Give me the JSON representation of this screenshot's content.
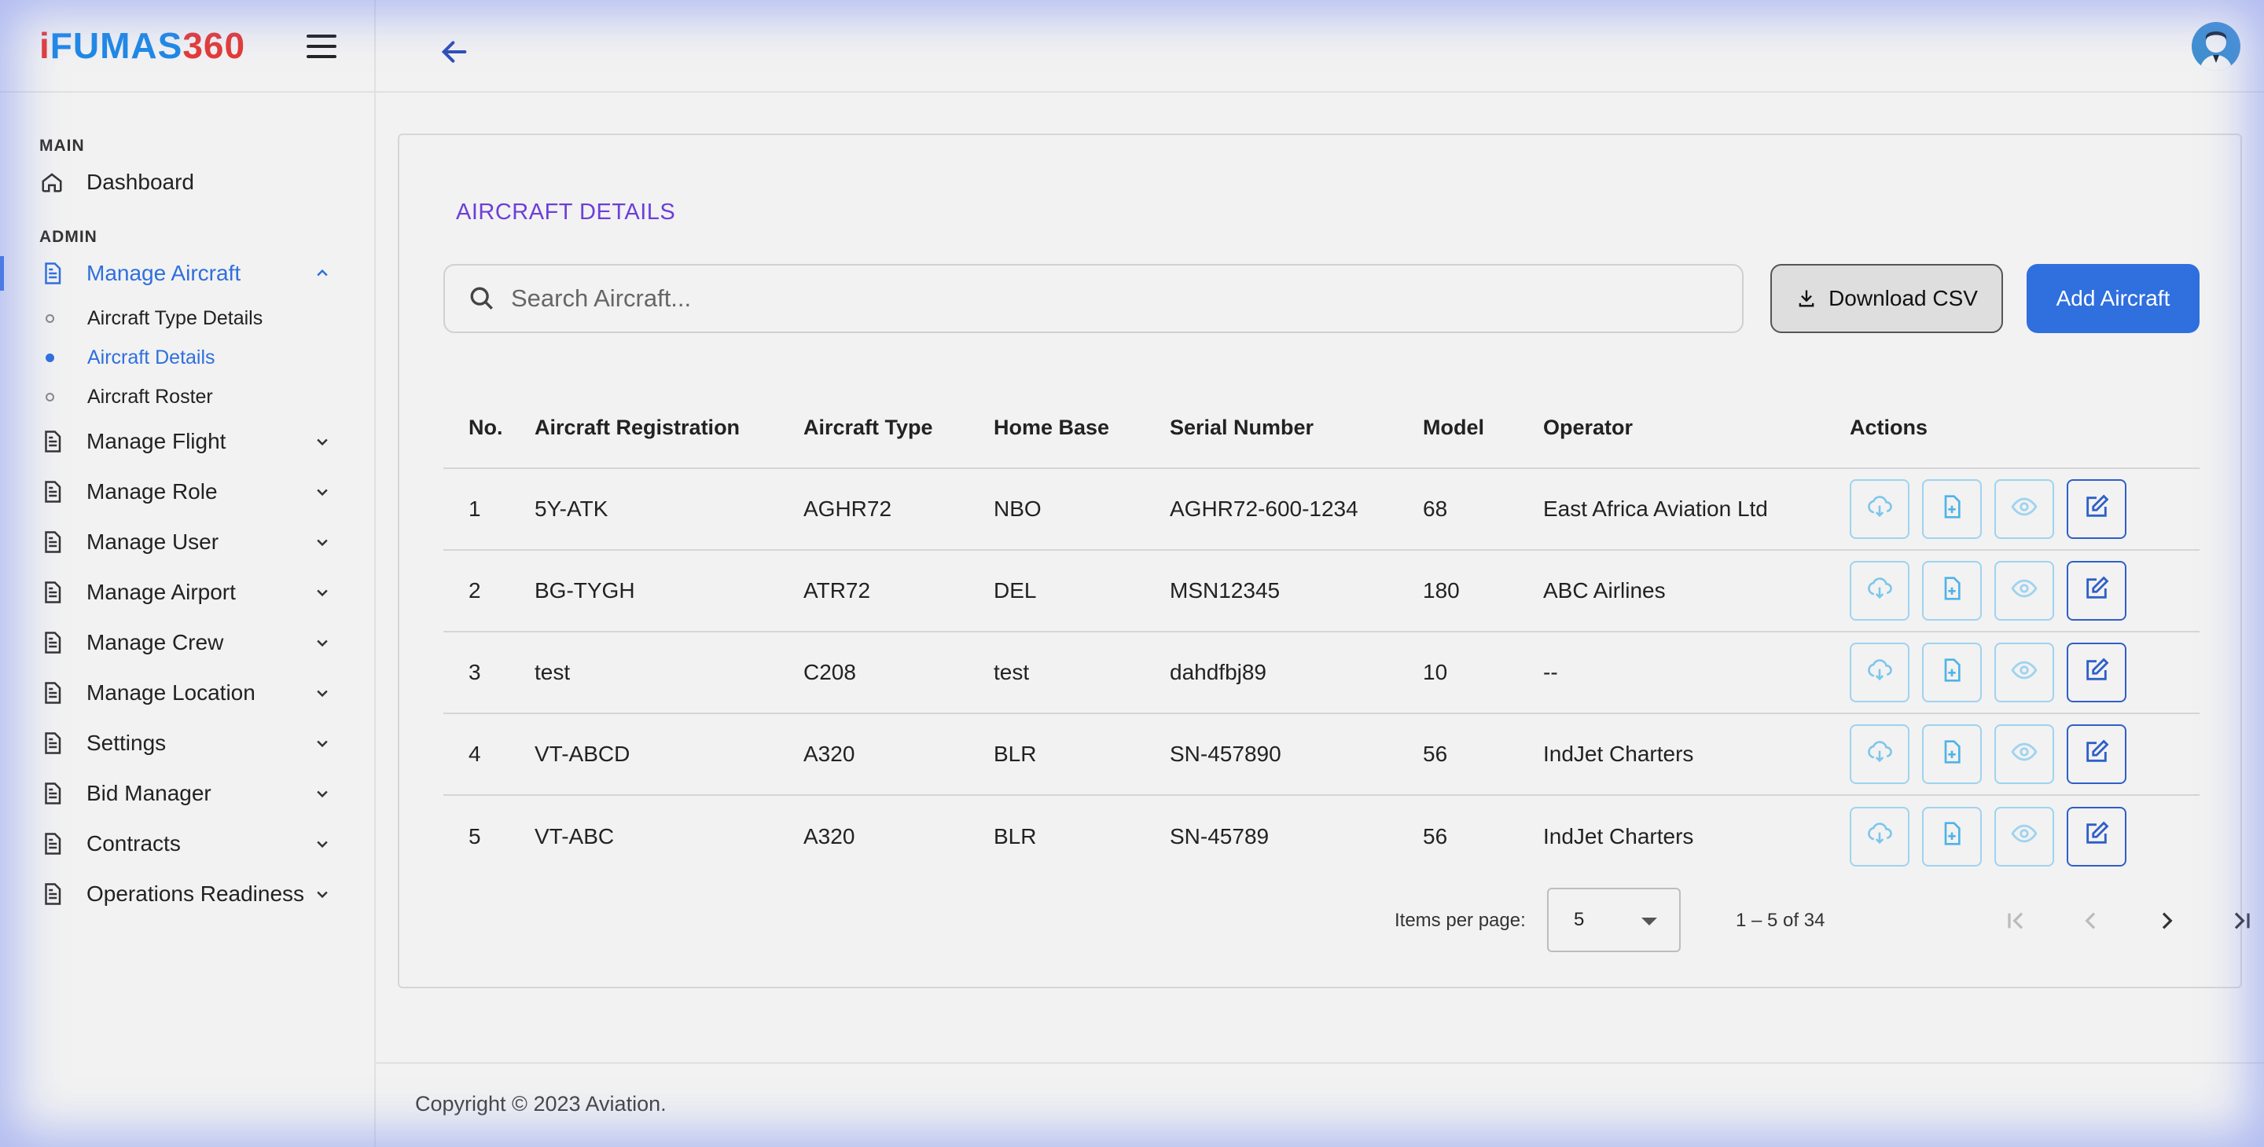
{
  "brand": {
    "logo_i": "i",
    "logo_f": "F",
    "logo_rest": "UMAS",
    "logo_num": "360"
  },
  "sidebar": {
    "section_main": "MAIN",
    "dashboard": "Dashboard",
    "section_admin": "ADMIN",
    "manage_aircraft": "Manage Aircraft",
    "sub_items": [
      "Aircraft Type Details",
      "Aircraft Details",
      "Aircraft Roster"
    ],
    "items": [
      "Manage Flight",
      "Manage Role",
      "Manage User",
      "Manage Airport",
      "Manage Crew",
      "Manage Location",
      "Settings",
      "Bid Manager",
      "Contracts",
      "Operations Readiness"
    ]
  },
  "page": {
    "title": "AIRCRAFT DETAILS",
    "search_placeholder": "Search Aircraft...",
    "download_label": "Download CSV",
    "add_label": "Add Aircraft"
  },
  "table": {
    "headers": [
      "No.",
      "Aircraft Registration",
      "Aircraft Type",
      "Home Base",
      "Serial Number",
      "Model",
      "Operator",
      "Actions"
    ],
    "rows": [
      [
        "1",
        "5Y-ATK",
        "AGHR72",
        "NBO",
        "AGHR72-600-1234",
        "68",
        "East Africa Aviation Ltd"
      ],
      [
        "2",
        "BG-TYGH",
        "ATR72",
        "DEL",
        "MSN12345",
        "180",
        "ABC Airlines"
      ],
      [
        "3",
        "test",
        "C208",
        "test",
        "dahdfbj89",
        "10",
        "--"
      ],
      [
        "4",
        "VT-ABCD",
        "A320",
        "BLR",
        "SN-457890",
        "56",
        "IndJet Charters"
      ],
      [
        "5",
        "VT-ABC",
        "A320",
        "BLR",
        "SN-45789",
        "56",
        "IndJet Charters"
      ]
    ]
  },
  "pagination": {
    "items_per_page_label": "Items per page:",
    "items_per_page": "5",
    "range": "1 – 5 of 34"
  },
  "footer": {
    "copyright": "Copyright © 2023 Aviation."
  },
  "colors": {
    "accent": "#2f6fde",
    "title": "#6c3fd8",
    "action_border": "#9fd3ef"
  }
}
